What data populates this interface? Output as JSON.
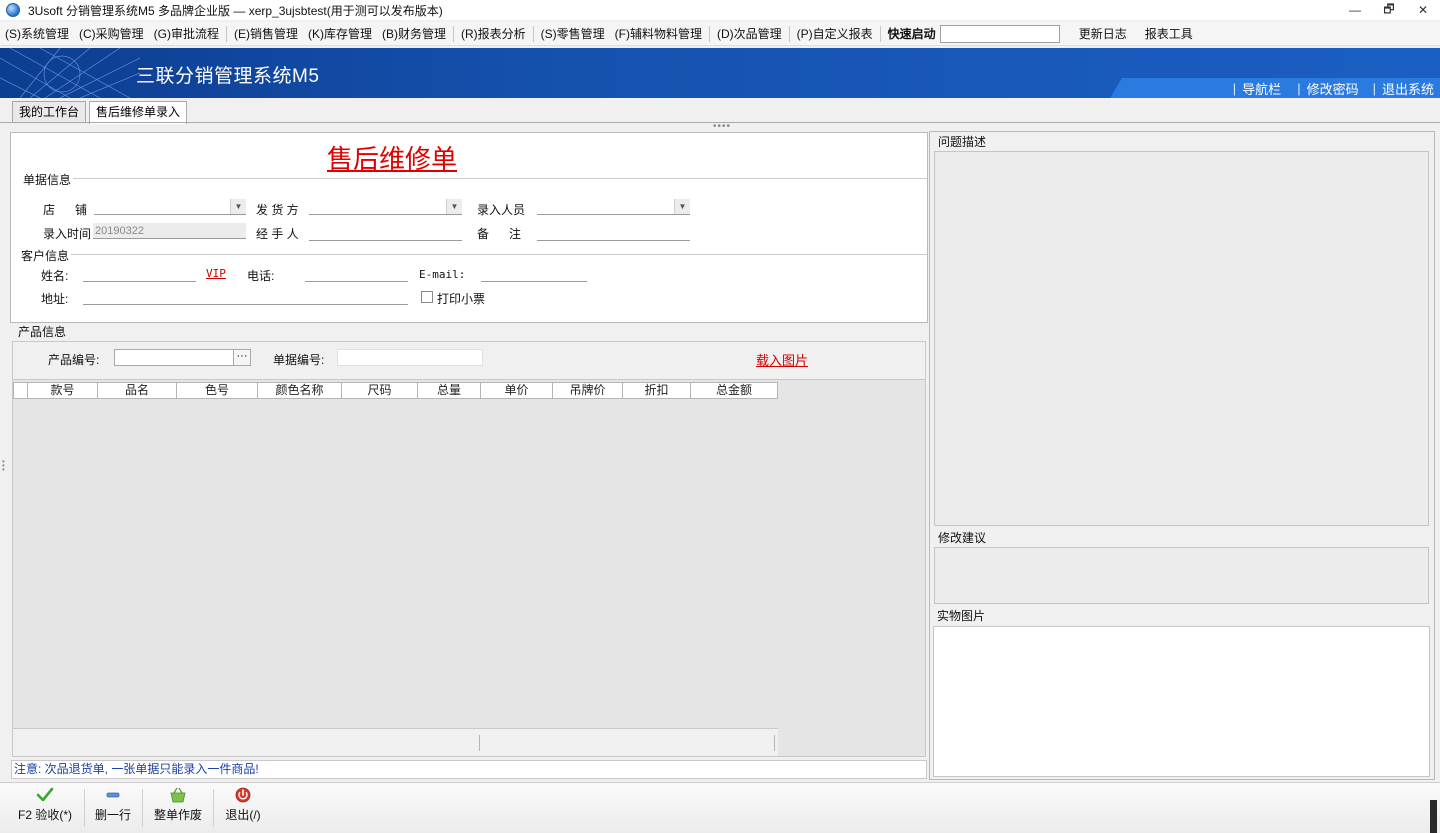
{
  "window": {
    "title": "3Usoft 分销管理系统M5 多品牌企业版 — xerp_3ujsbtest(用于测可以发布版本)",
    "minimize": "—",
    "restore": "🗗",
    "close": "✕"
  },
  "menu": {
    "items": [
      "(S)系统管理",
      "(C)采购管理",
      "(G)审批流程",
      "(E)销售管理",
      "(K)库存管理",
      "(B)财务管理",
      "(R)报表分析",
      "(S)零售管理",
      "(F)辅料物料管理",
      "(D)次品管理",
      "(P)自定义报表"
    ],
    "quick_launch_label": "快速启动",
    "update_log": "更新日志",
    "report_tool": "报表工具"
  },
  "banner": {
    "brand": "三联分销管理系统M5",
    "links": [
      "导航栏",
      "修改密码",
      "退出系统"
    ],
    "pipe": "|"
  },
  "tabs": [
    {
      "label": "我的工作台",
      "active": false
    },
    {
      "label": "售后维修单录入",
      "active": true
    }
  ],
  "splitter": "••••",
  "form": {
    "doc_title": "售后维修单",
    "section_doc": "单据信息",
    "store_label": "店      铺",
    "shipper_label": "发 货 方",
    "entry_person_label": "录入人员",
    "entry_time_label": "录入时间",
    "entry_time_value": "20190322",
    "handler_label": "经 手 人",
    "remark_label": "备      注",
    "section_customer": "客户信息",
    "name_label": "姓名:",
    "vip_label": "VIP",
    "phone_label": "电话:",
    "email_label": "E-mail:",
    "address_label": "地址:",
    "print_ticket_label": "打印小票"
  },
  "product": {
    "section_label": "产品信息",
    "code_label": "产品编号:",
    "doc_no_label": "单据编号:",
    "load_image": "载入图片",
    "columns": [
      "",
      "款号",
      "品名",
      "色号",
      "颜色名称",
      "尺码",
      "总量",
      "单价",
      "吊牌价",
      "折扣",
      "总金额"
    ]
  },
  "note": "注意: 次品退货单, 一张单据只能录入一件商品!",
  "right": {
    "problem_label": "问题描述",
    "suggest_label": "修改建议",
    "photo_label": "实物图片"
  },
  "toolbar": {
    "buttons": [
      {
        "label": "F2 验收(*)",
        "icon": "check-icon"
      },
      {
        "label": "删一行",
        "icon": "minus-icon"
      },
      {
        "label": "整单作废",
        "icon": "basket-icon"
      },
      {
        "label": "退出(/)",
        "icon": "power-icon"
      }
    ]
  },
  "colors": {
    "accent_red": "#e00000",
    "banner_blue": "#1552b0",
    "note_blue": "#1a3fa6"
  }
}
